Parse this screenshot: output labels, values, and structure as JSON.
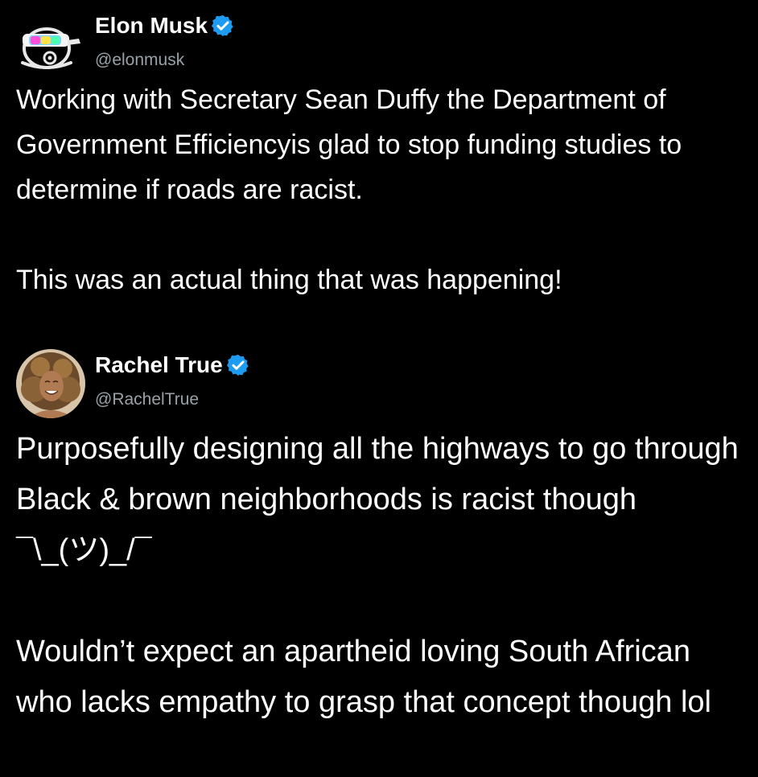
{
  "colors": {
    "background": "#000000",
    "text": "#ffffff",
    "handle": "#9aa1a8",
    "verified_badge": "#1d9bf0"
  },
  "posts": [
    {
      "display_name": "Elon Musk",
      "handle": "@elonmusk",
      "verified": true,
      "avatar_icon": "goggles-cartoon-avatar",
      "body": "Working with Secretary Sean Duffy the Department of Government Efficiencyis glad to stop funding studies to determine if roads are racist.\n\nThis was an actual thing that was happening!"
    },
    {
      "display_name": "Rachel True",
      "handle": "@RachelTrue",
      "verified": true,
      "avatar_icon": "profile-photo-avatar",
      "body": "Purposefully designing all the highways to go through Black & brown neighborhoods is racist though ¯\\_(ツ)_/¯\n\nWouldn’t expect an apartheid loving South African who lacks empathy to grasp that concept though lol"
    }
  ]
}
